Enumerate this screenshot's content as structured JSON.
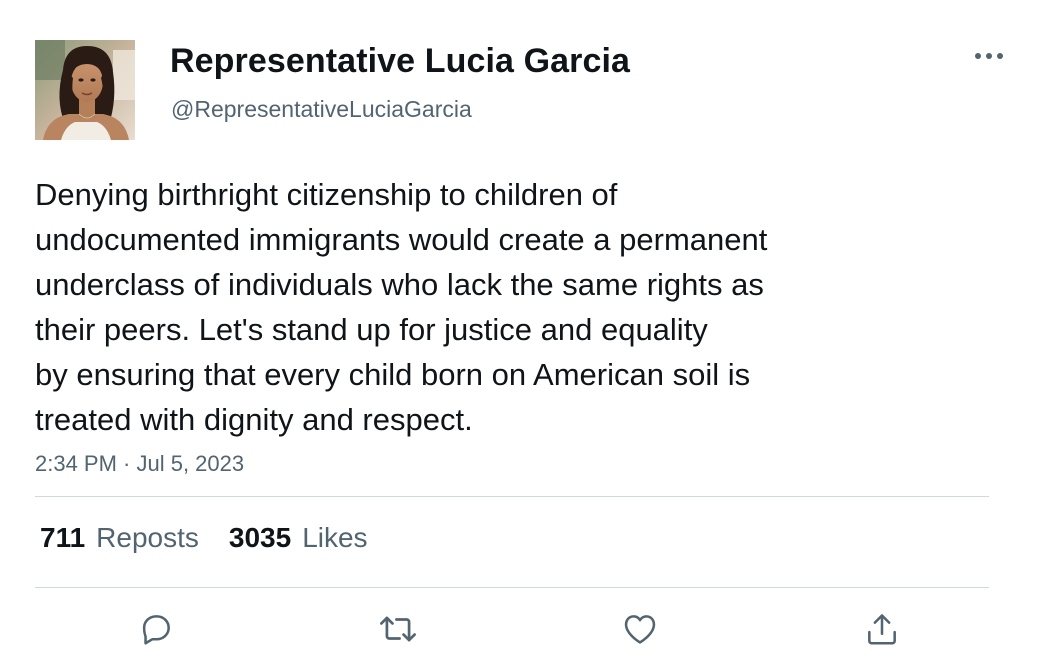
{
  "author": {
    "display_name": "Representative Lucia Garcia",
    "handle": "@RepresentativeLuciaGarcia",
    "avatar_icon": "profile-photo"
  },
  "more_icon": "ellipsis-icon",
  "tweet": {
    "text": "Denying birthright citizenship to children of\nundocumented immigrants would create a permanent\nunderclass of individuals who lack the same rights as\ntheir peers. Let's stand up for justice and equality\nby ensuring that every child born on American soil is\ntreated with dignity and respect.",
    "timestamp": "2:34 PM · Jul 5, 2023"
  },
  "stats": {
    "reposts_count": "711",
    "reposts_label": "Reposts",
    "likes_count": "3035",
    "likes_label": "Likes"
  },
  "actions": [
    {
      "icon": "reply-icon"
    },
    {
      "icon": "repost-icon"
    },
    {
      "icon": "like-icon"
    },
    {
      "icon": "share-icon"
    }
  ],
  "colors": {
    "text_primary": "#0f1419",
    "text_secondary": "#536471",
    "divider": "#cfd9de",
    "icon": "#536471"
  }
}
